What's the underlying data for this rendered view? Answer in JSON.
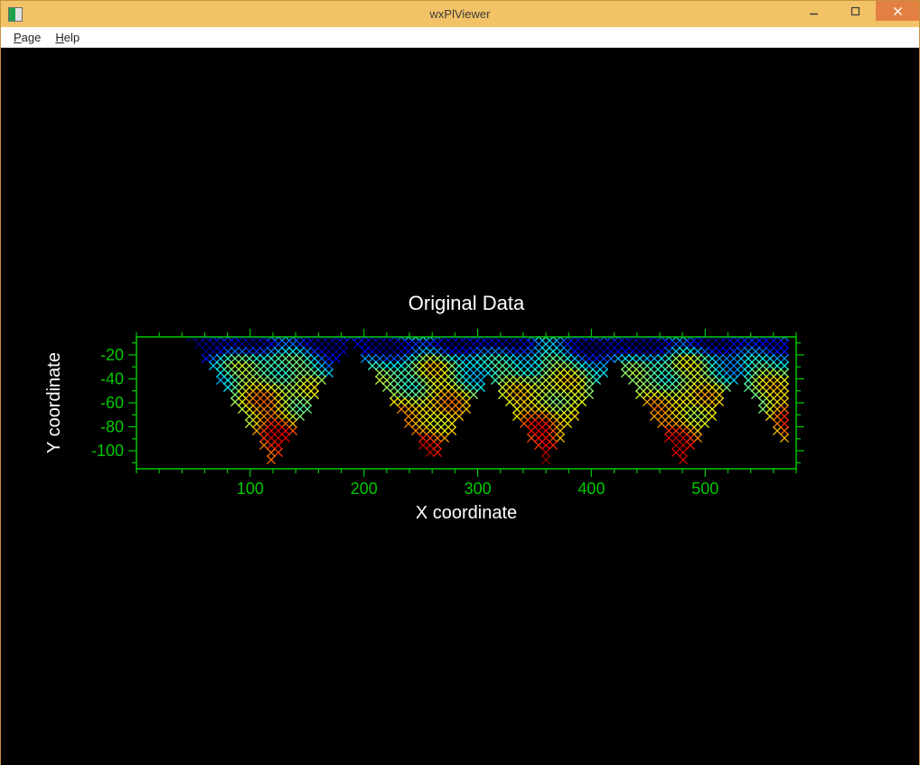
{
  "window": {
    "title": "wxPlViewer"
  },
  "menubar": {
    "page": "Page",
    "help": "Help"
  },
  "chart_data": {
    "type": "heatmap",
    "title": "Original Data",
    "xlabel": "X coordinate",
    "ylabel": "Y coordinate",
    "xlim": [
      0,
      580
    ],
    "ylim": [
      -115,
      -5
    ],
    "x_ticks_major": [
      100,
      200,
      300,
      400,
      500
    ],
    "x_ticks_minor_step": 20,
    "y_ticks_major": [
      -20,
      -40,
      -60,
      -80,
      -100
    ],
    "y_ticks_minor_step": 10,
    "colormap": "jet",
    "description": "Dense cross-hatched heatmap-style scatter on a black background. The plotted region forms a strip along the top of the axes that descends into several triangular downward points reaching y≈-110. Colors transition through green, cyan, blue, yellow, orange and red with cooler blue/purple near the top edge and warmer orange/red streaks near x≈130, x≈260, x≈400, x≈480.",
    "triangle_apexes_x": [
      120,
      260,
      360,
      480,
      580
    ],
    "triangle_apex_y": -110,
    "top_edge_y": -5,
    "axis_color": "#00c800",
    "text_color": "#ffffff"
  }
}
